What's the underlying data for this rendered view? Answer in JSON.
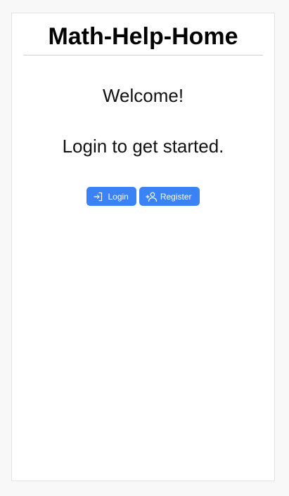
{
  "page": {
    "title": "Math-Help-Home",
    "welcome": "Welcome!",
    "prompt": "Login to get started."
  },
  "actions": {
    "login": {
      "label": "Login",
      "icon": "login-icon"
    },
    "register": {
      "label": "Register",
      "icon": "user-plus-icon"
    }
  },
  "colors": {
    "accent": "#3b82f6",
    "background": "#f8f8f8",
    "card": "#ffffff"
  }
}
